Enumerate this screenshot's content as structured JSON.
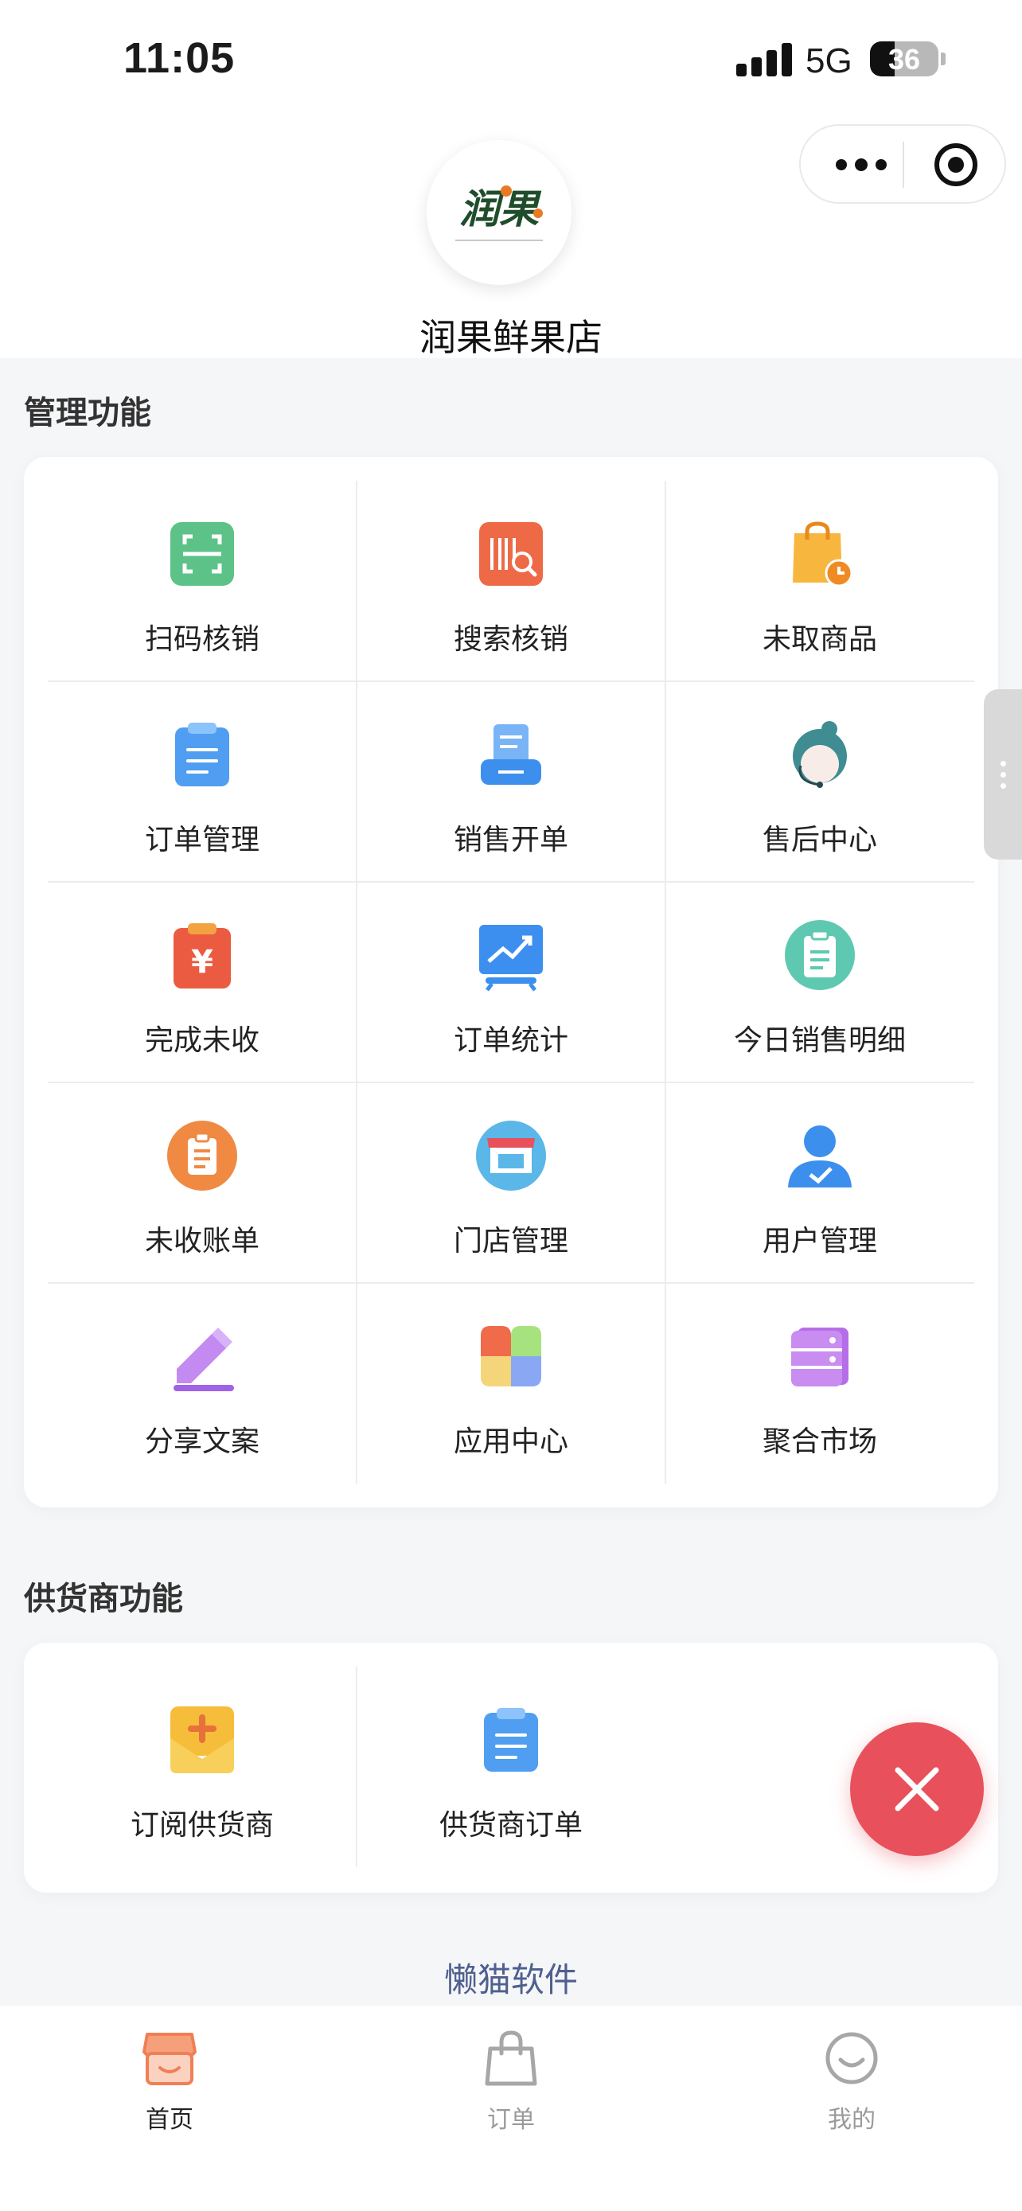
{
  "status_bar": {
    "time": "11:05",
    "network": "5G",
    "battery": 36
  },
  "header": {
    "store_name": "润果鲜果店",
    "logo_text": "润果"
  },
  "colors": {
    "accent": "#e8505b",
    "brand_link": "#4f5f8f",
    "tab_active": "#f07f55"
  },
  "management": {
    "title": "管理功能",
    "items": [
      {
        "label": "扫码核销",
        "icon": "scan-qrcode-icon"
      },
      {
        "label": "搜索核销",
        "icon": "barcode-search-icon"
      },
      {
        "label": "未取商品",
        "icon": "shopping-bag-clock-icon"
      },
      {
        "label": "订单管理",
        "icon": "clipboard-list-icon"
      },
      {
        "label": "销售开单",
        "icon": "printer-receipt-icon"
      },
      {
        "label": "售后中心",
        "icon": "customer-service-agent-icon"
      },
      {
        "label": "完成未收",
        "icon": "yuan-clipboard-icon"
      },
      {
        "label": "订单统计",
        "icon": "trend-chart-board-icon"
      },
      {
        "label": "今日销售明细",
        "icon": "daily-sales-clipboard-icon"
      },
      {
        "label": "未收账单",
        "icon": "unpaid-bill-icon"
      },
      {
        "label": "门店管理",
        "icon": "storefront-icon"
      },
      {
        "label": "用户管理",
        "icon": "user-check-icon"
      },
      {
        "label": "分享文案",
        "icon": "pencil-edit-icon"
      },
      {
        "label": "应用中心",
        "icon": "app-tiles-icon"
      },
      {
        "label": "聚合市场",
        "icon": "market-cabinet-icon"
      }
    ]
  },
  "supplier": {
    "title": "供货商功能",
    "items": [
      {
        "label": "订阅供货商",
        "icon": "subscribe-envelope-icon"
      },
      {
        "label": "供货商订单",
        "icon": "supplier-order-clipboard-icon"
      }
    ]
  },
  "footer_brand": "懒猫软件",
  "tabbar": [
    {
      "label": "首页",
      "icon": "home-store-icon",
      "active": true
    },
    {
      "label": "订单",
      "icon": "order-bag-icon",
      "active": false
    },
    {
      "label": "我的",
      "icon": "profile-smile-icon",
      "active": false
    }
  ]
}
